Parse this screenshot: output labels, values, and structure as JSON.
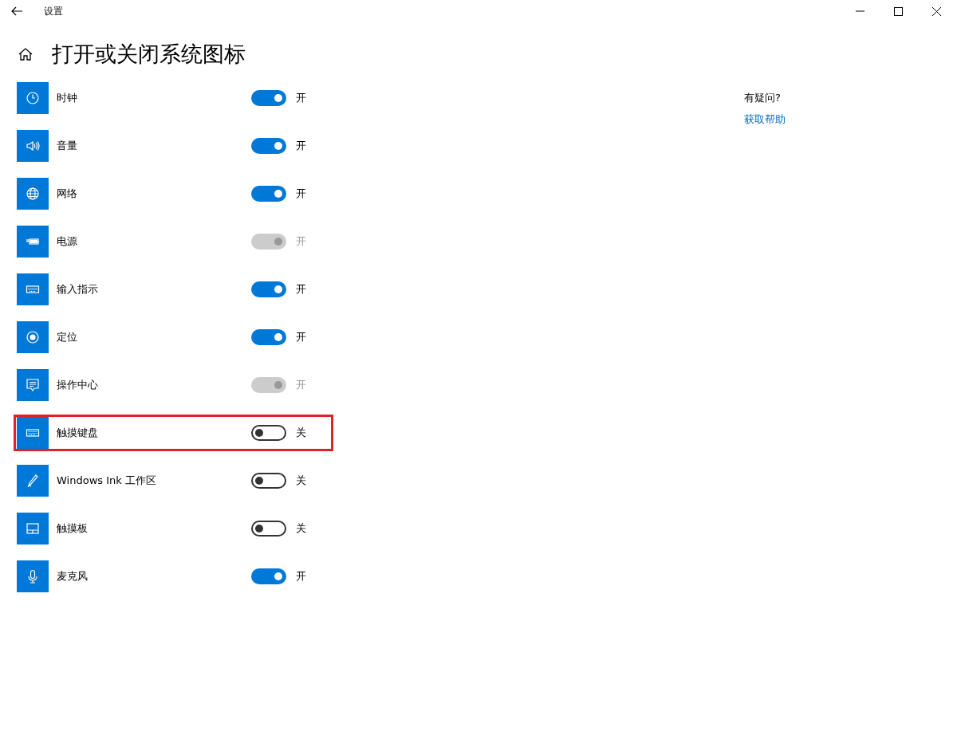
{
  "window": {
    "title": "设置"
  },
  "page": {
    "title": "打开或关闭系统图标"
  },
  "items": [
    {
      "label": "时钟",
      "on": true,
      "disabled": false,
      "state_text": "开",
      "highlighted": false
    },
    {
      "label": "音量",
      "on": true,
      "disabled": false,
      "state_text": "开",
      "highlighted": false
    },
    {
      "label": "网络",
      "on": true,
      "disabled": false,
      "state_text": "开",
      "highlighted": false
    },
    {
      "label": "电源",
      "on": true,
      "disabled": true,
      "state_text": "开",
      "highlighted": false
    },
    {
      "label": "输入指示",
      "on": true,
      "disabled": false,
      "state_text": "开",
      "highlighted": false
    },
    {
      "label": "定位",
      "on": true,
      "disabled": false,
      "state_text": "开",
      "highlighted": false
    },
    {
      "label": "操作中心",
      "on": true,
      "disabled": true,
      "state_text": "开",
      "highlighted": false
    },
    {
      "label": "触摸键盘",
      "on": false,
      "disabled": false,
      "state_text": "关",
      "highlighted": true
    },
    {
      "label": "Windows Ink 工作区",
      "on": false,
      "disabled": false,
      "state_text": "关",
      "highlighted": false
    },
    {
      "label": "触摸板",
      "on": false,
      "disabled": false,
      "state_text": "关",
      "highlighted": false
    },
    {
      "label": "麦克风",
      "on": true,
      "disabled": false,
      "state_text": "开",
      "highlighted": false
    }
  ],
  "help": {
    "heading": "有疑问?",
    "link": "获取帮助"
  }
}
